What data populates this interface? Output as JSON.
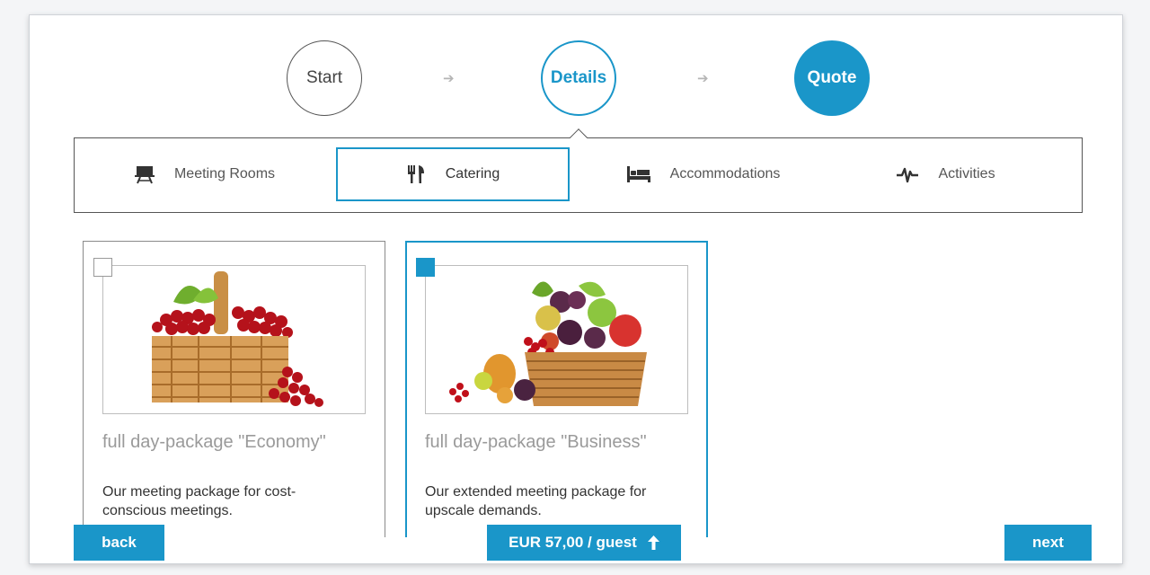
{
  "steps": {
    "start": "Start",
    "details": "Details",
    "quote": "Quote",
    "arrow_icon": "right-arrow-icon"
  },
  "tabs": [
    {
      "label": "Meeting Rooms",
      "icon": "presentation-board-icon"
    },
    {
      "label": "Catering",
      "icon": "fork-knife-icon",
      "selected": true
    },
    {
      "label": "Accommodations",
      "icon": "bed-icon"
    },
    {
      "label": "Activities",
      "icon": "pulse-icon"
    }
  ],
  "packages": [
    {
      "title": "full day-package \"Economy\"",
      "description": "Our meeting package for cost-conscious meetings.",
      "checked": false,
      "image": "grape-basket-image"
    },
    {
      "title": "full day-package \"Business\"",
      "description": "Our extended meeting package for upscale demands.",
      "checked": true,
      "image": "fruit-basket-image"
    }
  ],
  "footer": {
    "back_label": "back",
    "price_label": "EUR 57,00 / guest",
    "next_label": "next"
  },
  "colors": {
    "accent": "#1a96c9",
    "muted_title": "#9a9a9a"
  }
}
